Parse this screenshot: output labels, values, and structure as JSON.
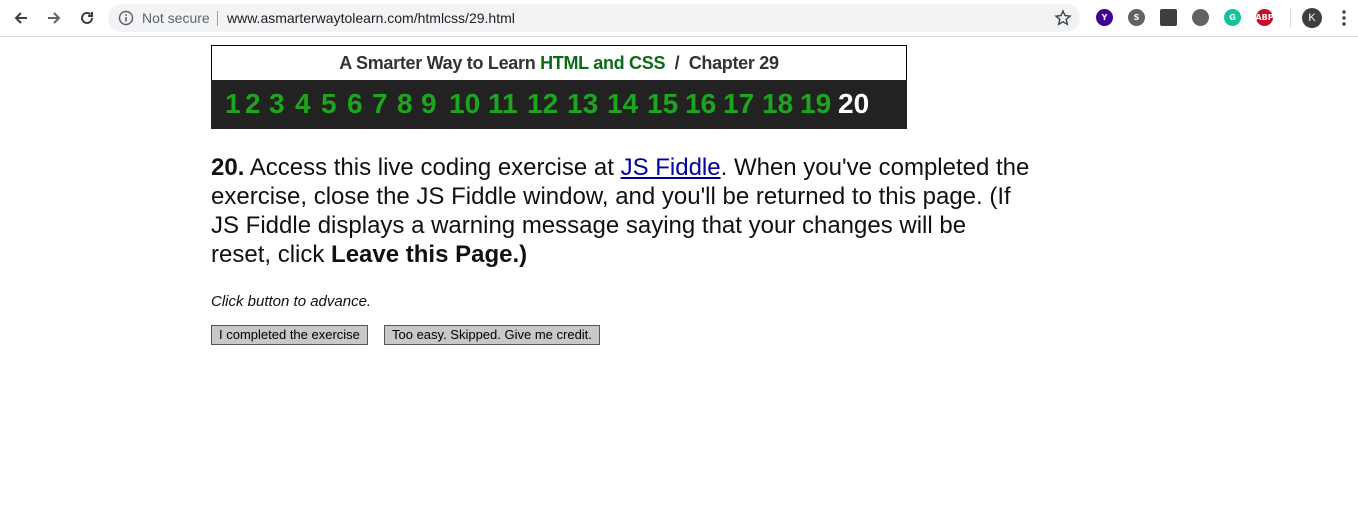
{
  "browser": {
    "security_label": "Not secure",
    "url": "www.asmarterwaytolearn.com/htmlcss/29.html",
    "avatar_letter": "K",
    "extensions": [
      {
        "name": "yahoo-extension-icon",
        "label": "Y",
        "color": "#410093"
      },
      {
        "name": "skype-extension-icon",
        "label": "S",
        "color": "#5f6368"
      },
      {
        "name": "chart-extension-icon",
        "label": "",
        "color": "#3c4043"
      },
      {
        "name": "circle-extension-icon",
        "label": "",
        "color": "#5f6368"
      },
      {
        "name": "grammarly-extension-icon",
        "label": "G",
        "color": "#15c39a"
      },
      {
        "name": "adblock-extension-icon",
        "label": "ABP",
        "color": "#c70d2c"
      }
    ]
  },
  "header": {
    "prefix": "A Smarter Way to Learn",
    "brand": "HTML and CSS",
    "separator": "/",
    "chapter": "Chapter 29"
  },
  "nav_numbers": [
    "1",
    "2",
    "3",
    "4",
    "5",
    "6",
    "7",
    "8",
    "9",
    "10",
    "11",
    "12",
    "13",
    "14",
    "15",
    "16",
    "17",
    "18",
    "19",
    "20"
  ],
  "current_number": "20",
  "question": {
    "number": "20.",
    "text_before_link": "Access this live coding exercise at",
    "link_text": "JS Fiddle",
    "text_after_link": ". When you've completed the exercise, close the JS Fiddle window, and you'll be returned to this page. (If JS Fiddle displays a warning message saying that your changes will be reset, click",
    "bold_end": "Leave this Page.)"
  },
  "instruction": "Click button to advance.",
  "buttons": {
    "completed": "I completed the exercise",
    "skip": "Too easy. Skipped. Give me credit."
  },
  "colors": {
    "nav_green": "#1ea51e",
    "brand_green": "#0b6b16",
    "nav_bar_bg": "#222222",
    "link_blue": "#0000a0"
  }
}
